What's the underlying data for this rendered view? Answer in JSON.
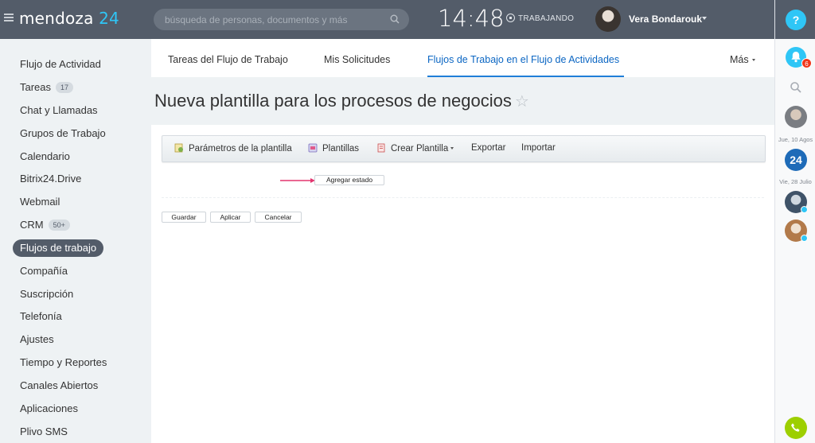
{
  "header": {
    "logo_name": "mendoza",
    "logo_num": "24",
    "search_placeholder": "búsqueda de personas, documentos y más",
    "time": "14:48",
    "status": "TRABAJANDO",
    "user_name": "Vera Bondarouk"
  },
  "right_panel": {
    "help": "?",
    "notifications_count": "6",
    "date1": "Jue, 10 Agos",
    "b24_label": "24",
    "date2": "Vie, 28 Julio"
  },
  "sidebar": {
    "items": [
      {
        "label": "Flujo de Actividad"
      },
      {
        "label": "Tareas",
        "counter": "17"
      },
      {
        "label": "Chat y Llamadas"
      },
      {
        "label": "Grupos de Trabajo"
      },
      {
        "label": "Calendario"
      },
      {
        "label": "Bitrix24.Drive"
      },
      {
        "label": "Webmail"
      },
      {
        "label": "CRM",
        "counter": "50+"
      },
      {
        "label": "Flujos de trabajo",
        "active": true
      },
      {
        "label": "Compañía"
      },
      {
        "label": "Suscripción"
      },
      {
        "label": "Telefonía"
      },
      {
        "label": "Ajustes"
      },
      {
        "label": "Tiempo y Reportes"
      },
      {
        "label": "Canales Abiertos"
      },
      {
        "label": "Aplicaciones"
      },
      {
        "label": "Plivo SMS"
      }
    ]
  },
  "tabs": [
    {
      "label": "Tareas del Flujo de Trabajo"
    },
    {
      "label": "Mis Solicitudes"
    },
    {
      "label": "Flujos de Trabajo en el Flujo de Actividades",
      "active": true
    },
    {
      "label": "Más"
    }
  ],
  "page": {
    "title": "Nueva plantilla para los procesos de negocios",
    "star": "☆"
  },
  "toolbar": {
    "params": "Parámetros de la plantilla",
    "templates": "Plantillas",
    "create": "Crear Plantilla",
    "export": "Exportar",
    "import": "Importar"
  },
  "designer": {
    "add_state": "Agregar estado"
  },
  "footer": {
    "save": "Guardar",
    "apply": "Aplicar",
    "cancel": "Cancelar"
  },
  "colors": {
    "header_bg": "#535c69",
    "accent": "#2fc6f6",
    "active_tab": "#0b66c3",
    "arrow": "#e3356f"
  }
}
